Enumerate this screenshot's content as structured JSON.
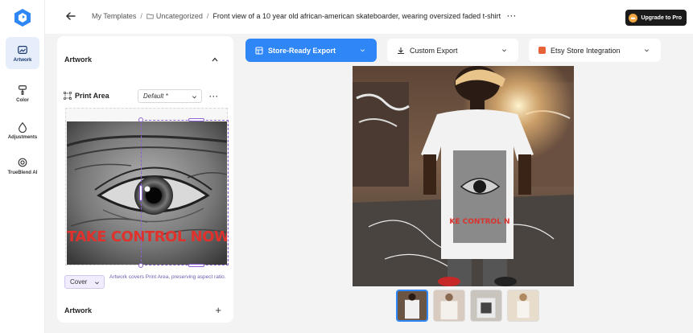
{
  "rail": {
    "items": [
      {
        "label": "Artwork",
        "icon": "artwork-icon",
        "active": true
      },
      {
        "label": "Color",
        "icon": "paint-roller-icon"
      },
      {
        "label": "Adjustments",
        "icon": "drop-icon"
      },
      {
        "label": "TrueBlend AI",
        "icon": "ai-chip-icon"
      }
    ]
  },
  "topbar": {
    "crumbs": [
      "My Templates",
      "Uncategorized",
      "Front view of a 10 year old african-american skateboarder, wearing oversized faded t-shirt"
    ],
    "more": "···",
    "upgrade_label": "Upgrade to Pro"
  },
  "panel": {
    "title": "Artwork",
    "print_area_label": "Print Area",
    "print_area_value": "Default *",
    "more": "···",
    "artwork_text": "TAKE CONTROL NOW",
    "fit_value": "Cover",
    "fit_note": "Artwork covers Print Area, preserving aspect ratio.",
    "artwork_section": "Artwork",
    "add": "+"
  },
  "exports": {
    "store": "Store-Ready Export",
    "custom": "Custom Export",
    "etsy": "Etsy Store Integration"
  },
  "colors": {
    "accent": "#2f86f6",
    "text_red": "#e0322d",
    "selection": "#8d60d6",
    "etsy": "#e8623a"
  }
}
